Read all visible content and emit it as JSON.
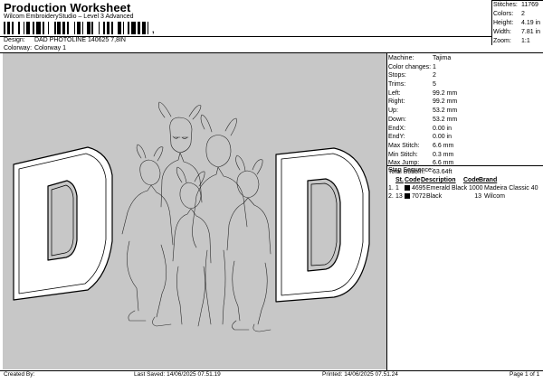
{
  "header": {
    "title": "Production Worksheet",
    "subtitle": "Wilcom EmbroideryStudio – Level 3 Advanced",
    "barcode_suffix": ","
  },
  "design": {
    "label": "Design:",
    "value": "DAD PHOTOLINE 140625 7,8IN"
  },
  "colorway": {
    "label": "Colorway:",
    "value": "Colorway 1"
  },
  "summary": [
    {
      "label": "Stitches:",
      "value": "11769"
    },
    {
      "label": "Colors:",
      "value": "2"
    },
    {
      "label": "Height:",
      "value": "4.19 in"
    },
    {
      "label": "Width:",
      "value": "7.81 in"
    },
    {
      "label": "Zoom:",
      "value": "1:1"
    }
  ],
  "machine_info": [
    {
      "label": "Machine:",
      "value": "Tajima"
    },
    {
      "label": "Color changes:",
      "value": "1"
    },
    {
      "label": "Stops:",
      "value": "2"
    },
    {
      "label": "Trims:",
      "value": "5"
    },
    {
      "label": "Left:",
      "value": "99.2 mm"
    },
    {
      "label": "Right:",
      "value": "99.2 mm"
    },
    {
      "label": "Up:",
      "value": "53.2 mm"
    },
    {
      "label": "Down:",
      "value": "53.2 mm"
    },
    {
      "label": "EndX:",
      "value": "0.00 in"
    },
    {
      "label": "EndY:",
      "value": "0.00 in"
    },
    {
      "label": "Max Stitch:",
      "value": "6.6 mm"
    },
    {
      "label": "Min Stitch:",
      "value": "0.3 mm"
    },
    {
      "label": "Max Jump:",
      "value": "6.6 mm"
    },
    {
      "label": "Total Bobbin:",
      "value": "63.64ft"
    }
  ],
  "stop_sequence": {
    "title": "Stop Sequence:",
    "headers": {
      "st": "St.",
      "code": "Code",
      "description": "Description",
      "code2": "Code",
      "brand": "Brand"
    },
    "rows": [
      {
        "idx": "1.",
        "n": "1",
        "code": "4695",
        "description": "Emerald Black",
        "stitches": "1000",
        "brand": "Madeira Classic 40"
      },
      {
        "idx": "2.",
        "n": "13",
        "code": "7072",
        "description": "Black",
        "stitches": "13",
        "brand": "Wilcom"
      }
    ]
  },
  "footer": {
    "created_by": "Created By:",
    "last_saved": "Last Saved: 14/06/2025 07.51.19",
    "printed": "Printed: 14/06/2025 07.51.24",
    "page": "Page 1 of 1"
  },
  "colors": {
    "canvas_bg": "#c7c7c7",
    "thread_fill": "#ffffff",
    "thread_outline": "#000000"
  }
}
